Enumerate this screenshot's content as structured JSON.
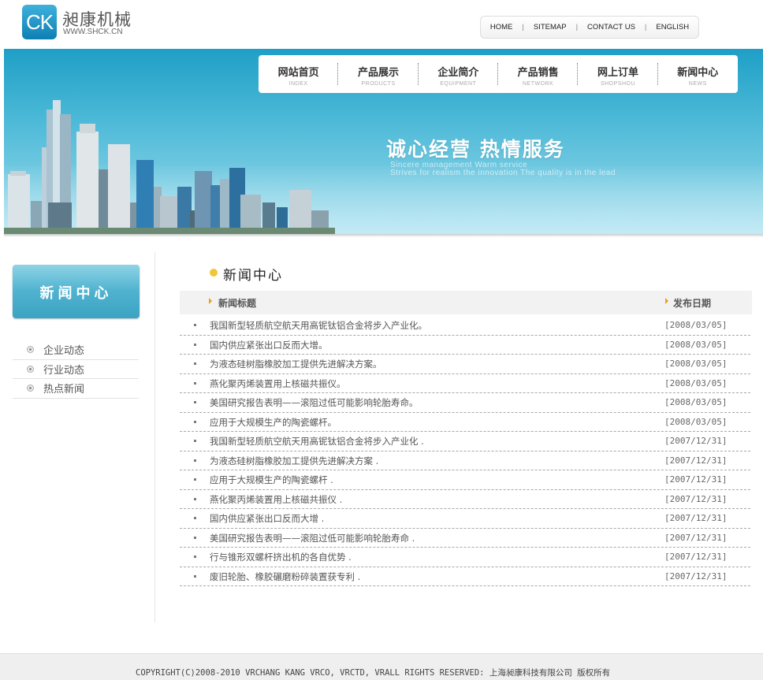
{
  "header": {
    "logo_letters": "CK",
    "company_name": "昶康机械",
    "website": "WWW.SHCK.CN",
    "top_links": [
      "HOME",
      "SITEMAP",
      "CONTACT US",
      "ENGLISH"
    ]
  },
  "main_nav": [
    {
      "cn": "网站首页",
      "en": "INDEX"
    },
    {
      "cn": "产品展示",
      "en": "PRODUCTS"
    },
    {
      "cn": "企业简介",
      "en": "EQUIPMENT"
    },
    {
      "cn": "产品销售",
      "en": "NETWORK"
    },
    {
      "cn": "网上订单",
      "en": "SHOPSHOU"
    },
    {
      "cn": "新闻中心",
      "en": "NEWS"
    }
  ],
  "banner": {
    "slogan": "诚心经营 热情服务",
    "slogan_en_1": "Sincere management  Warm service",
    "slogan_en_2": "Strives for realism the innovation The quality is in the lead"
  },
  "sidebar": {
    "heading": "新闻中心",
    "items": [
      "企业动态",
      "行业动态",
      "热点新闻"
    ]
  },
  "news": {
    "heading": "新闻中心",
    "col_title": "新闻标题",
    "col_date": "发布日期",
    "rows": [
      {
        "title": "我国新型轻质航空航天用高铌钛铝合金将步入产业化。",
        "date": "[2008/03/05]"
      },
      {
        "title": "国内供应紧张出口反而大增。",
        "date": "[2008/03/05]"
      },
      {
        "title": "为液态硅树脂橡胶加工提供先进解决方案。",
        "date": "[2008/03/05]"
      },
      {
        "title": "燕化聚丙烯装置用上核磁共振仪。",
        "date": "[2008/03/05]"
      },
      {
        "title": "美国研究报告表明——滚阻过低可能影响轮胎寿命。",
        "date": "[2008/03/05]"
      },
      {
        "title": "应用于大规模生产的陶瓷螺杆。",
        "date": "[2008/03/05]"
      },
      {
        "title": "我国新型轻质航空航天用高铌钛铝合金将步入产业化 .",
        "date": "[2007/12/31]"
      },
      {
        "title": "为液态硅树脂橡胶加工提供先进解决方案 .",
        "date": "[2007/12/31]"
      },
      {
        "title": "应用于大规模生产的陶瓷螺杆 .",
        "date": "[2007/12/31]"
      },
      {
        "title": "燕化聚丙烯装置用上核磁共振仪 .",
        "date": "[2007/12/31]"
      },
      {
        "title": "国内供应紧张出口反而大增 .",
        "date": "[2007/12/31]"
      },
      {
        "title": "美国研究报告表明——滚阻过低可能影响轮胎寿命 .",
        "date": "[2007/12/31]"
      },
      {
        "title": "行与锥形双螺杆挤出机的各自优势 .",
        "date": "[2007/12/31]"
      },
      {
        "title": "废旧轮胎、橡胶碾磨粉碎装置获专利 .",
        "date": "[2007/12/31]"
      }
    ]
  },
  "footer": {
    "copyright": "COPYRIGHT(C)2008-2010 VRCHANG KANG  VRCO, VRCTD, VRALL RIGHTS RESERVED: 上海昶康科技有限公司 版权所有"
  }
}
